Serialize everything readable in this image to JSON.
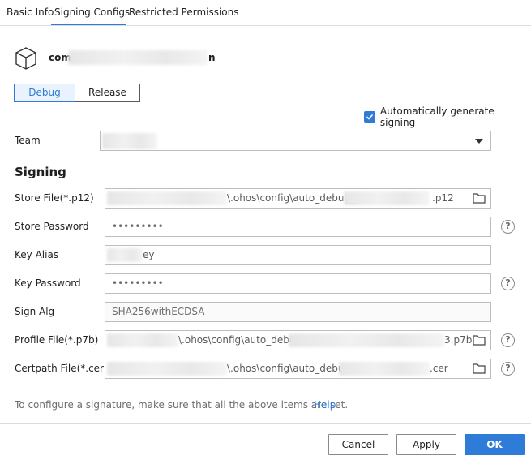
{
  "tabs": [
    {
      "label": "Basic Info"
    },
    {
      "label": "Signing Configs"
    },
    {
      "label": "Restricted Permissions"
    }
  ],
  "module": {
    "name_prefix": "com",
    "name_suffix": "n"
  },
  "modes": {
    "debug": "Debug",
    "release": "Release"
  },
  "auto_sign": {
    "label": "Automatically generate signing",
    "checked": true
  },
  "team": {
    "label": "Team",
    "value": ""
  },
  "signing": {
    "title": "Signing",
    "store_file": {
      "label": "Store File(*.p12)",
      "value_mid": "\\.ohos\\config\\auto_debug_",
      "value_end": ".p12"
    },
    "store_password": {
      "label": "Store Password",
      "value": "•••••••••"
    },
    "key_alias": {
      "label": "Key Alias",
      "value_end": "ey"
    },
    "key_password": {
      "label": "Key Password",
      "value": "•••••••••"
    },
    "sign_alg": {
      "label": "Sign Alg",
      "value": "SHA256withECDSA"
    },
    "profile_file": {
      "label": "Profile File(*.p7b)",
      "value_mid": "\\.ohos\\config\\auto_debug",
      "value_end": "3.p7b"
    },
    "certpath_file": {
      "label": "Certpath File(*.cer)",
      "value_mid": "\\.ohos\\config\\auto_debug",
      "value_end": ".cer"
    }
  },
  "hint": {
    "text": "To configure a signature, make sure that all the above items are set.",
    "help": "Help"
  },
  "help_glyph": "?",
  "footer": {
    "cancel": "Cancel",
    "apply": "Apply",
    "ok": "OK"
  },
  "colors": {
    "accent": "#2f7bd8"
  }
}
